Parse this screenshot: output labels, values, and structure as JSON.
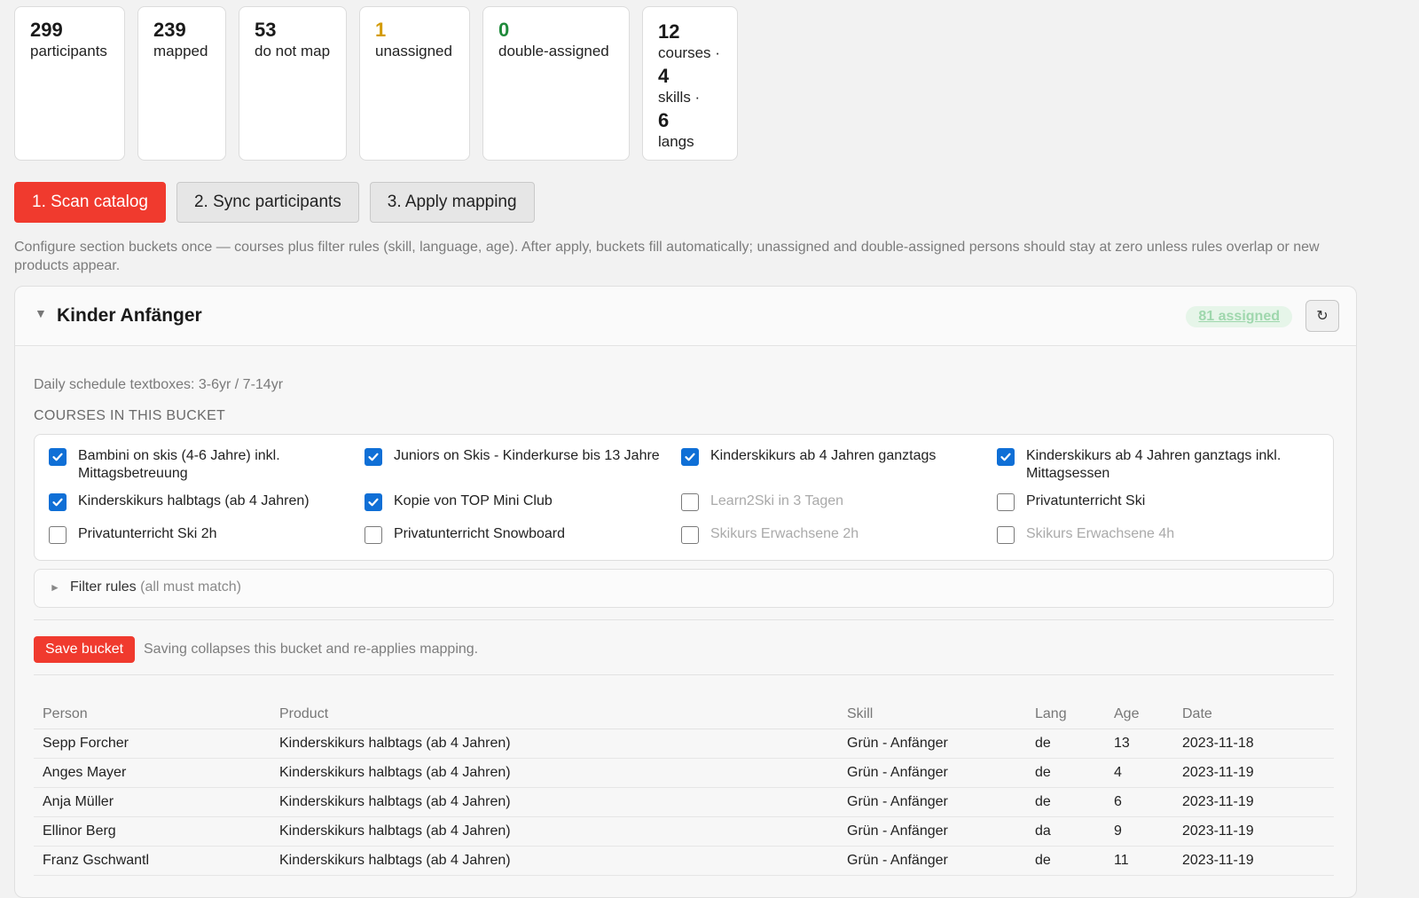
{
  "stats": [
    {
      "value": "299",
      "label": "participants",
      "color": "#1a1a1a"
    },
    {
      "value": "239",
      "label": "mapped",
      "color": "#1a1a1a"
    },
    {
      "value": "53",
      "label": "do not map",
      "color": "#1a1a1a"
    },
    {
      "value": "1",
      "label": "unassigned",
      "color": "#d39b06"
    },
    {
      "value": "0",
      "label": "double-assigned",
      "color": "#1f8a3b"
    }
  ],
  "summary": {
    "courses_value": "12",
    "courses_label": "courses ·",
    "skills_value": "4",
    "skills_label": "skills ·",
    "langs_value": "6",
    "langs_label": "langs"
  },
  "steps": {
    "scan": "1. Scan catalog",
    "sync": "2. Sync participants",
    "apply": "3. Apply mapping"
  },
  "intro": "Configure section buckets once — courses plus filter rules (skill, language, age). After apply, buckets fill automatically; unassigned and double-assigned persons should stay at zero unless rules overlap or new products appear.",
  "bucket": {
    "title": "Kinder Anfänger",
    "assigned": "81 assigned",
    "schedule": "Daily schedule textboxes: 3-6yr / 7-14yr",
    "courses_heading": "COURSES IN THIS BUCKET",
    "courses": [
      {
        "label": "Bambini on skis (4-6 Jahre) inkl. Mittagsbetreuung",
        "checked": true,
        "disabled": false
      },
      {
        "label": "Juniors on Skis - Kinderkurse bis 13 Jahre",
        "checked": true,
        "disabled": false
      },
      {
        "label": "Kinderskikurs ab 4 Jahren ganztags",
        "checked": true,
        "disabled": false
      },
      {
        "label": "Kinderskikurs ab 4 Jahren ganztags inkl. Mittagsessen",
        "checked": true,
        "disabled": false
      },
      {
        "label": "Kinderskikurs halbtags (ab 4 Jahren)",
        "checked": true,
        "disabled": false
      },
      {
        "label": "Kopie von TOP Mini Club",
        "checked": true,
        "disabled": false
      },
      {
        "label": "Learn2Ski in 3 Tagen",
        "checked": false,
        "disabled": true
      },
      {
        "label": "Privatunterricht Ski",
        "checked": false,
        "disabled": false
      },
      {
        "label": "Privatunterricht Ski 2h",
        "checked": false,
        "disabled": false
      },
      {
        "label": "Privatunterricht Snowboard",
        "checked": false,
        "disabled": false
      },
      {
        "label": "Skikurs Erwachsene 2h",
        "checked": false,
        "disabled": true
      },
      {
        "label": "Skikurs Erwachsene 4h",
        "checked": false,
        "disabled": true
      }
    ],
    "filter_label": "Filter rules",
    "filter_hint": "(all must match)",
    "save_label": "Save bucket",
    "save_hint": "Saving collapses this bucket and re-applies mapping."
  },
  "table": {
    "headers": [
      "Person",
      "Product",
      "Skill",
      "Lang",
      "Age",
      "Date"
    ],
    "rows": [
      [
        "Sepp Forcher",
        "Kinderskikurs halbtags (ab 4 Jahren)",
        "Grün - Anfänger",
        "de",
        "13",
        "2023-11-18"
      ],
      [
        "Anges Mayer",
        "Kinderskikurs halbtags (ab 4 Jahren)",
        "Grün - Anfänger",
        "de",
        "4",
        "2023-11-19"
      ],
      [
        "Anja Müller",
        "Kinderskikurs halbtags (ab 4 Jahren)",
        "Grün - Anfänger",
        "de",
        "6",
        "2023-11-19"
      ],
      [
        "Ellinor Berg",
        "Kinderskikurs halbtags (ab 4 Jahren)",
        "Grün - Anfänger",
        "da",
        "9",
        "2023-11-19"
      ],
      [
        "Franz Gschwantl",
        "Kinderskikurs halbtags (ab 4 Jahren)",
        "Grün - Anfänger",
        "de",
        "11",
        "2023-11-19"
      ]
    ]
  }
}
